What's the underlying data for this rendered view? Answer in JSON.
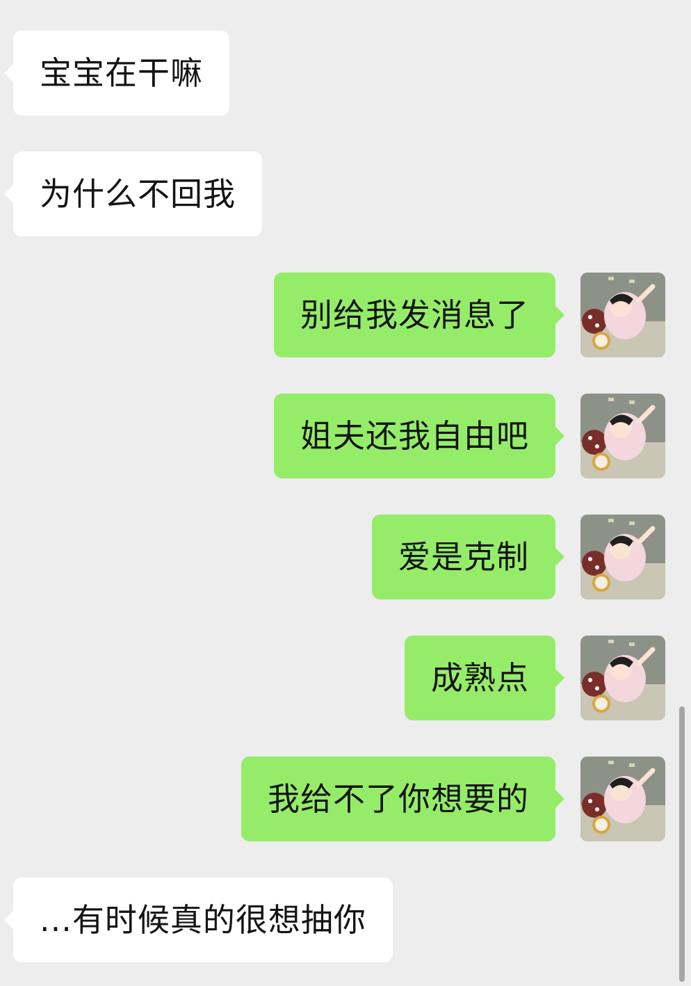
{
  "chat": {
    "messages": [
      {
        "side": "left",
        "text": "宝宝在干嘛"
      },
      {
        "side": "left",
        "text": "为什么不回我"
      },
      {
        "side": "right",
        "text": "别给我发消息了",
        "avatar": "user-avatar-icon"
      },
      {
        "side": "right",
        "text": "姐夫还我自由吧",
        "avatar": "user-avatar-icon"
      },
      {
        "side": "right",
        "text": "爱是克制",
        "avatar": "user-avatar-icon"
      },
      {
        "side": "right",
        "text": "成熟点",
        "avatar": "user-avatar-icon"
      },
      {
        "side": "right",
        "text": "我给不了你想要的",
        "avatar": "user-avatar-icon"
      },
      {
        "side": "left",
        "text": "...有时候真的很想抽你"
      }
    ]
  },
  "colors": {
    "background": "#ededed",
    "incoming_bubble": "#ffffff",
    "outgoing_bubble": "#95ec69",
    "text": "#141414"
  }
}
